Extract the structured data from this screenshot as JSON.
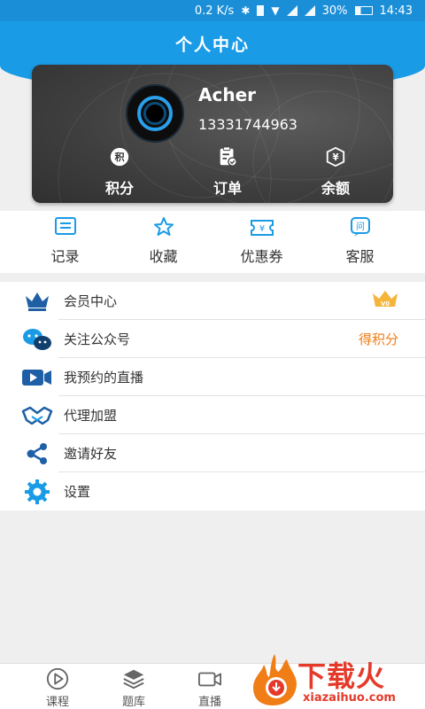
{
  "status_bar": {
    "speed": "0.2 K/s",
    "battery": "30%",
    "time": "14:43"
  },
  "header": {
    "title": "个人中心"
  },
  "profile": {
    "name": "Acher",
    "phone": "13331744963",
    "stats": [
      {
        "label": "积分",
        "icon": "points-icon",
        "glyph": "积"
      },
      {
        "label": "订单",
        "icon": "order-icon"
      },
      {
        "label": "余额",
        "icon": "balance-icon",
        "glyph": "¥"
      }
    ]
  },
  "quick_links": [
    {
      "label": "记录",
      "icon": "record-icon"
    },
    {
      "label": "收藏",
      "icon": "star-icon"
    },
    {
      "label": "优惠券",
      "icon": "coupon-icon",
      "glyph": "¥"
    },
    {
      "label": "客服",
      "icon": "customer-service-icon",
      "glyph": "问"
    }
  ],
  "menu": [
    {
      "label": "会员中心",
      "icon": "crown-icon",
      "badge": "V0"
    },
    {
      "label": "关注公众号",
      "icon": "wechat-icon",
      "right_text": "得积分"
    },
    {
      "label": "我预约的直播",
      "icon": "video-icon"
    },
    {
      "label": "代理加盟",
      "icon": "handshake-icon"
    },
    {
      "label": "邀请好友",
      "icon": "share-icon"
    },
    {
      "label": "设置",
      "icon": "gear-icon"
    }
  ],
  "tabs": [
    {
      "label": "课程",
      "icon": "play-icon"
    },
    {
      "label": "题库",
      "icon": "layers-icon"
    },
    {
      "label": "直播",
      "icon": "camera-icon"
    }
  ],
  "watermark": {
    "title": "下载火",
    "sub": "xiazaihuo.com"
  },
  "colors": {
    "primary": "#1a9be6",
    "accent": "#f07d16",
    "crown": "#f5b43a"
  }
}
